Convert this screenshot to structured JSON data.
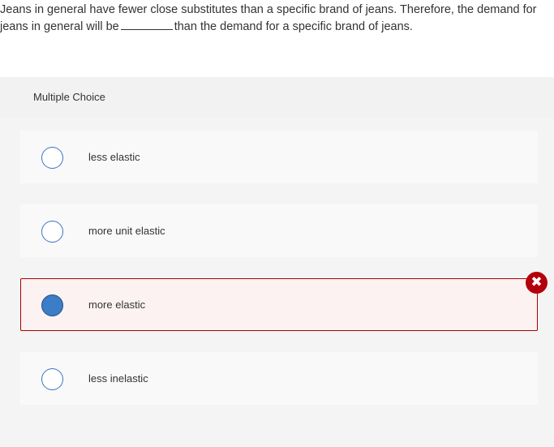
{
  "question": {
    "text_part1": "Jeans in general have fewer close substitutes than a specific brand of jeans. Therefore, the demand for jeans in general will be",
    "text_part2": "than the demand for a specific brand of jeans."
  },
  "answer_type_label": "Multiple Choice",
  "choices": [
    {
      "label": "less elastic",
      "selected": false
    },
    {
      "label": "more unit elastic",
      "selected": false
    },
    {
      "label": "more elastic",
      "selected": true,
      "status": "incorrect"
    },
    {
      "label": "less inelastic",
      "selected": false
    }
  ],
  "colors": {
    "radio_border": "#3a74c4",
    "radio_fill": "#3c7dc7",
    "incorrect_border": "#a80000",
    "incorrect_background": "#fdf2f2",
    "incorrect_icon": "#b3000c"
  },
  "icons": {
    "incorrect": "x-circle-icon"
  }
}
